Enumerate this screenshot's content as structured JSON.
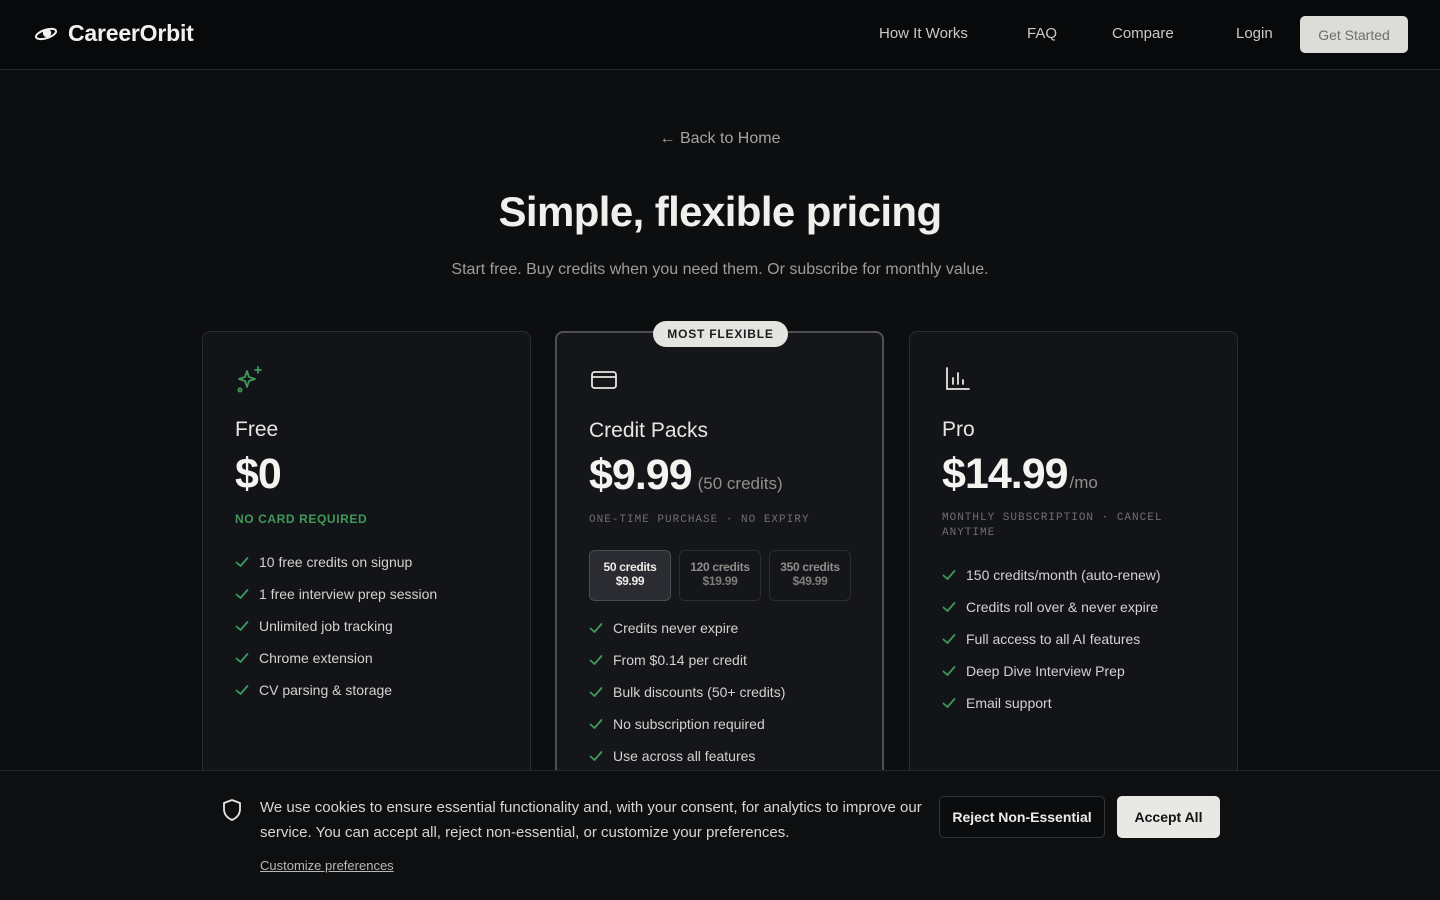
{
  "brand": {
    "name": "CareerOrbit"
  },
  "nav": {
    "links": [
      "How It Works",
      "FAQ",
      "Compare",
      "Login"
    ],
    "cta": "Get Started"
  },
  "hero": {
    "back": "← Back to Home",
    "title": "Simple, flexible pricing",
    "subtitle": "Start free. Buy credits when you need them. Or subscribe for monthly value."
  },
  "plans": [
    {
      "icon": "sparkles-icon",
      "name": "Free",
      "price": "$0",
      "suffix": "",
      "note": "NO CARD REQUIRED",
      "features": [
        "10 free credits on signup",
        "1 free interview prep session",
        "Unlimited job tracking",
        "Chrome extension",
        "CV parsing & storage"
      ]
    },
    {
      "icon": "credit-card-icon",
      "badge": "MOST FLEXIBLE",
      "name": "Credit Packs",
      "price": "$9.99",
      "suffix": "(50 credits)",
      "note": "ONE-TIME PURCHASE · NO EXPIRY",
      "packs": [
        {
          "credits": "50 credits",
          "price": "$9.99",
          "selected": true
        },
        {
          "credits": "120 credits",
          "price": "$19.99",
          "selected": false
        },
        {
          "credits": "350 credits",
          "price": "$49.99",
          "selected": false
        }
      ],
      "features": [
        "Credits never expire",
        "From $0.14 per credit",
        "Bulk discounts (50+ credits)",
        "No subscription required",
        "Use across all features"
      ]
    },
    {
      "icon": "bar-chart-icon",
      "name": "Pro",
      "price": "$14.99",
      "suffix": "/mo",
      "note": "MONTHLY SUBSCRIPTION · CANCEL ANYTIME",
      "features": [
        "150 credits/month (auto-renew)",
        "Credits roll over & never expire",
        "Full access to all AI features",
        "Deep Dive Interview Prep",
        "Email support"
      ]
    }
  ],
  "cookie": {
    "text": "We use cookies to ensure essential functionality and, with your consent, for analytics to improve our service. You can accept all, reject non-essential, or customize your preferences.",
    "customize": "Customize preferences",
    "reject": "Reject Non-Essential",
    "accept": "Accept All"
  },
  "colors": {
    "accent_green": "#3f9a5a",
    "background": "#0d0e10"
  }
}
